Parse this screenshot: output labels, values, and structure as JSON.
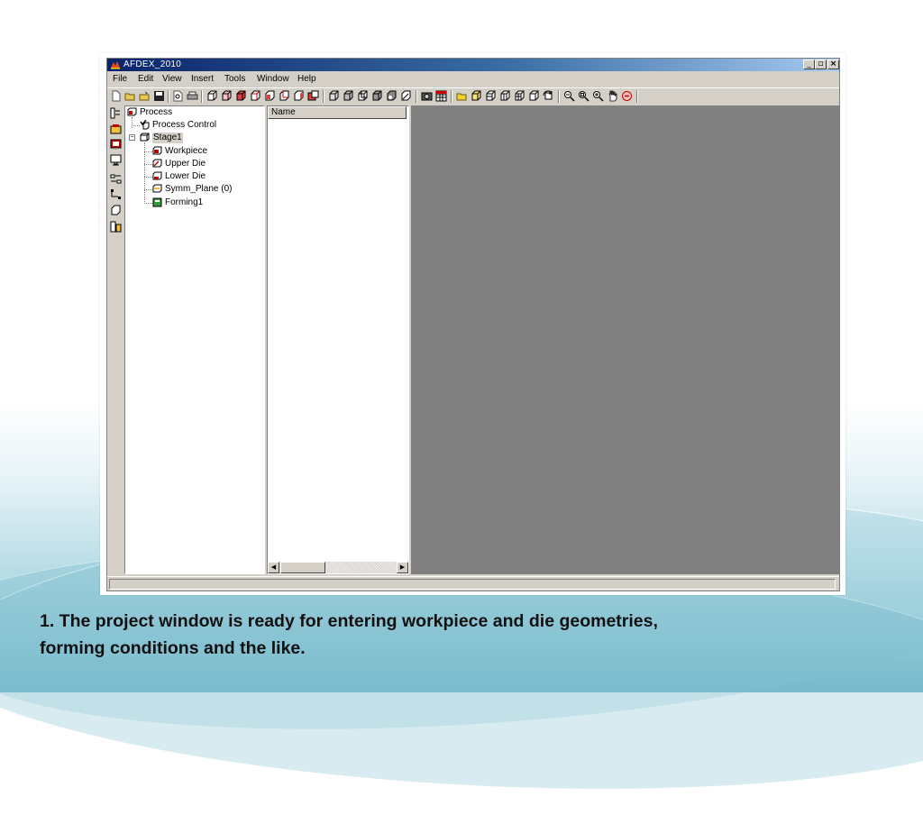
{
  "window": {
    "title": "AFDEX_2010",
    "controls": {
      "minimize": "_",
      "restore": "▫",
      "close": "×"
    }
  },
  "menu": [
    "File",
    "Edit",
    "View",
    "Insert",
    "Tools",
    "Window",
    "Help"
  ],
  "toolbar_icons": [
    "new-file-icon",
    "open-folder-icon",
    "open-file-icon",
    "save-icon",
    "print-preview-icon",
    "print-icon",
    "model-view-1-icon",
    "model-view-2-icon",
    "model-view-3-icon",
    "model-view-4-icon",
    "model-view-5-icon",
    "model-view-6-icon",
    "model-view-7-icon",
    "model-view-8-icon",
    "shade-1-icon",
    "shade-2-icon",
    "shade-3-icon",
    "shade-4-icon",
    "shade-5-icon",
    "shade-6-icon",
    "camera-icon",
    "grid-icon",
    "open-view-icon",
    "iso-view-1-icon",
    "iso-view-2-icon",
    "iso-view-3-icon",
    "iso-view-4-icon",
    "iso-view-5-icon",
    "rotate-view-icon",
    "zoom-fit-icon",
    "zoom-window-icon",
    "zoom-in-icon",
    "pan-icon",
    "reset-view-icon"
  ],
  "tree": {
    "root": "Process",
    "process_control": "Process Control",
    "stage": "Stage1",
    "children": [
      "Workpiece",
      "Upper Die",
      "Lower Die",
      "Symm_Plane (0)",
      "Forming1"
    ]
  },
  "list": {
    "column": "Name"
  },
  "caption": {
    "line1": "1. The project window is ready for entering workpiece and die geometries,",
    "line2": "forming conditions and the like."
  },
  "colors": {
    "title_gradient_start": "#0a246a",
    "title_gradient_end": "#a6caf0",
    "viewport": "#808080",
    "chrome": "#d4d0c8"
  }
}
